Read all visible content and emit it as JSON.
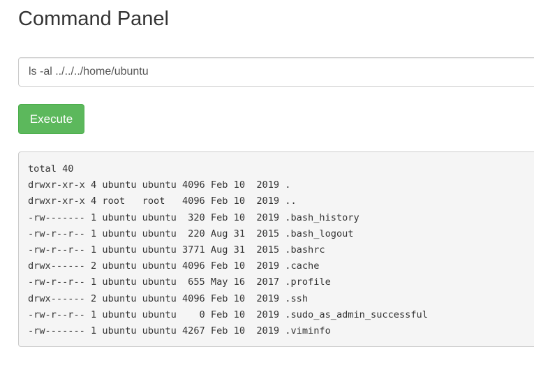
{
  "page": {
    "title": "Command Panel"
  },
  "command": {
    "value": "ls -al ../../../home/ubuntu"
  },
  "execute_button": {
    "label": "Execute",
    "color": "#5cb85c"
  },
  "output": {
    "lines": [
      "total 40",
      "drwxr-xr-x 4 ubuntu ubuntu 4096 Feb 10  2019 .",
      "drwxr-xr-x 4 root   root   4096 Feb 10  2019 ..",
      "-rw------- 1 ubuntu ubuntu  320 Feb 10  2019 .bash_history",
      "-rw-r--r-- 1 ubuntu ubuntu  220 Aug 31  2015 .bash_logout",
      "-rw-r--r-- 1 ubuntu ubuntu 3771 Aug 31  2015 .bashrc",
      "drwx------ 2 ubuntu ubuntu 4096 Feb 10  2019 .cache",
      "-rw-r--r-- 1 ubuntu ubuntu  655 May 16  2017 .profile",
      "drwx------ 2 ubuntu ubuntu 4096 Feb 10  2019 .ssh",
      "-rw-r--r-- 1 ubuntu ubuntu    0 Feb 10  2019 .sudo_as_admin_successful",
      "-rw------- 1 ubuntu ubuntu 4267 Feb 10  2019 .viminfo"
    ]
  }
}
